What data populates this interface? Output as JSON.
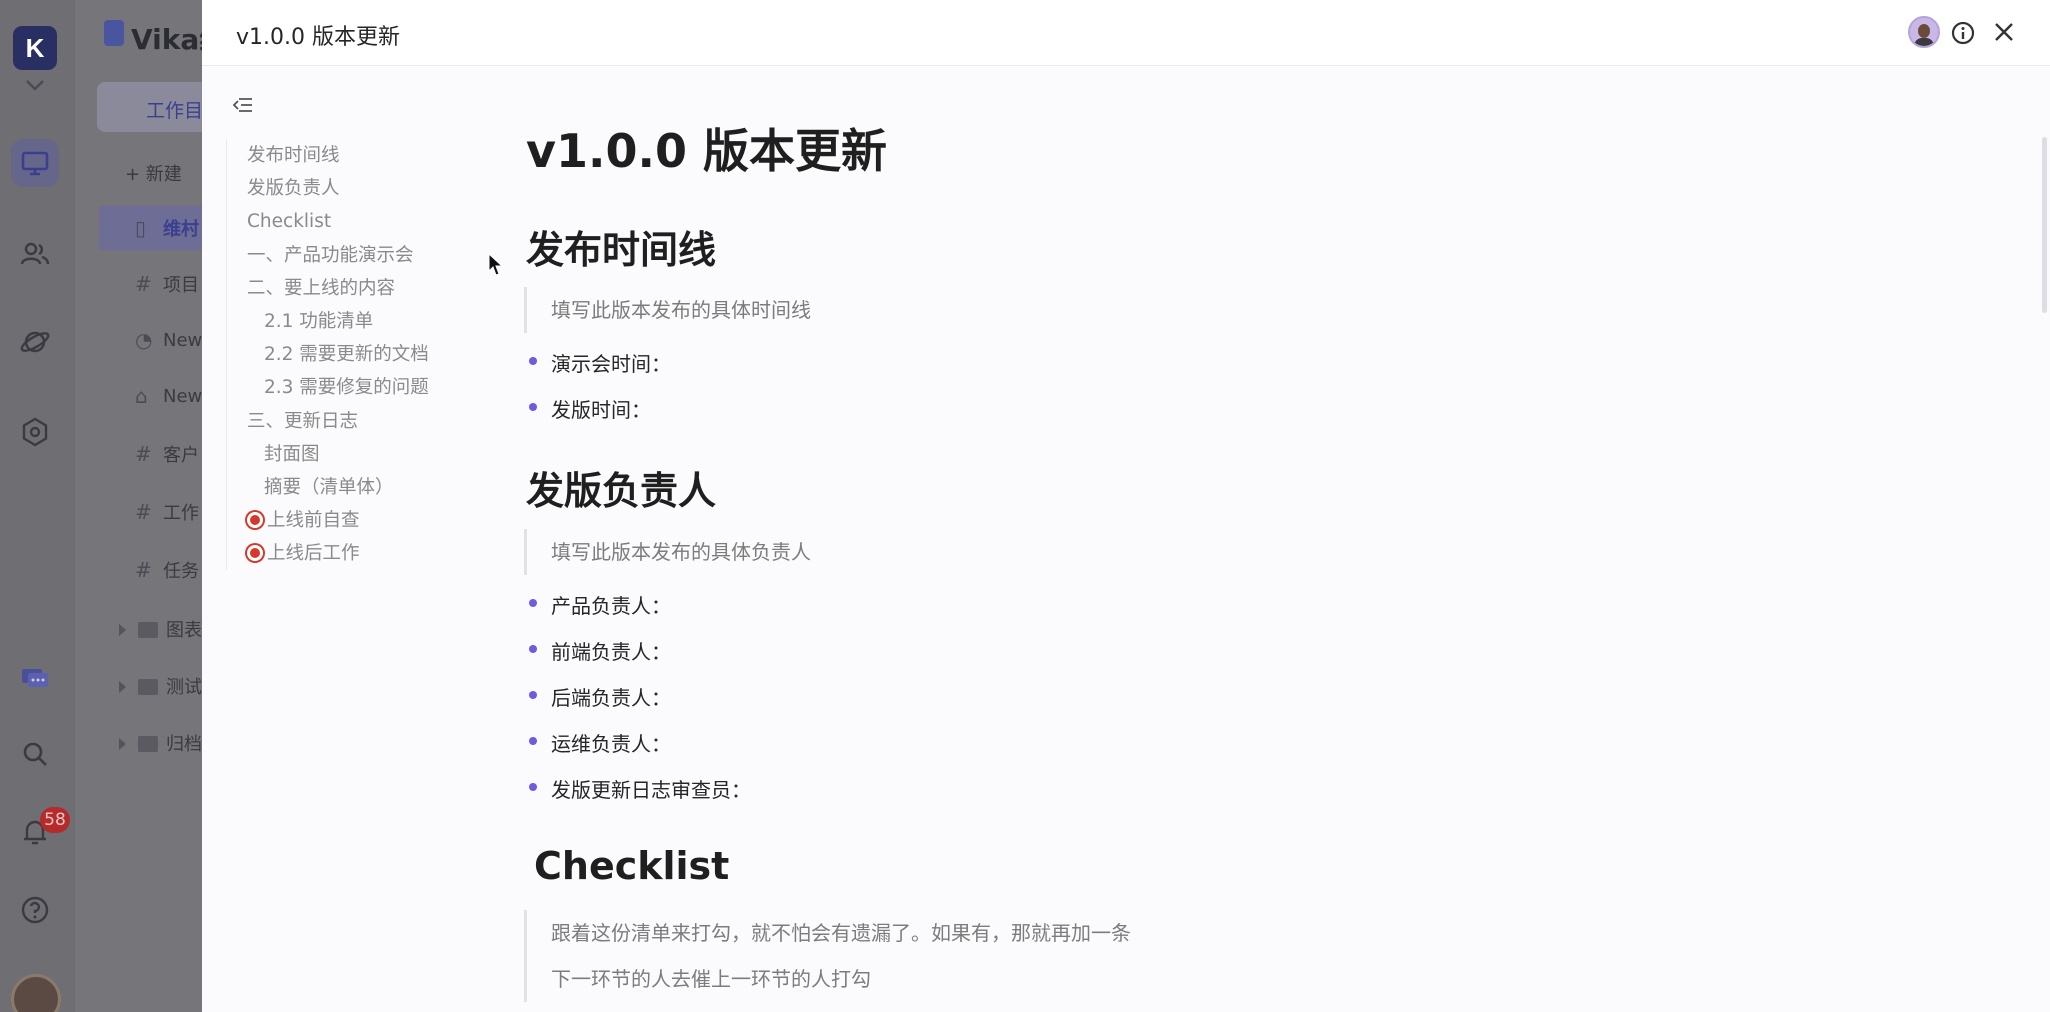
{
  "background": {
    "space_name": "Vika维",
    "catalog_tab": "工作目",
    "new_label": "+ 新建",
    "items": [
      {
        "icon": "book-icon",
        "label": "维村"
      },
      {
        "icon": "grid-icon",
        "label": "项目"
      },
      {
        "icon": "dashboard-icon",
        "label": "New"
      },
      {
        "icon": "robot-icon",
        "label": "New"
      },
      {
        "icon": "grid-icon",
        "label": "客户"
      },
      {
        "icon": "grid-icon",
        "label": "工作"
      },
      {
        "icon": "grid-icon",
        "label": "任务"
      }
    ],
    "folders": [
      "图表",
      "测试",
      "归档"
    ],
    "notification_count": "58"
  },
  "drawer": {
    "title": "v1.0.0 版本更新"
  },
  "toc": [
    {
      "label": "发布时间线",
      "level": 1
    },
    {
      "label": "发版负责人",
      "level": 1
    },
    {
      "label": "Checklist",
      "level": 1
    },
    {
      "label": "一、产品功能演示会",
      "level": 1
    },
    {
      "label": "二、要上线的内容",
      "level": 1
    },
    {
      "label": "2.1 功能清单",
      "level": 2
    },
    {
      "label": "2.2 需要更新的文档",
      "level": 2
    },
    {
      "label": "2.3 需要修复的问题",
      "level": 2
    },
    {
      "label": "三、更新日志",
      "level": 1
    },
    {
      "label": "封面图",
      "level": 2
    },
    {
      "label": "摘要（清单体）",
      "level": 2
    },
    {
      "label": "上线前自查",
      "level": 1,
      "emoji": "target-icon"
    },
    {
      "label": "上线后工作",
      "level": 1,
      "emoji": "target-icon"
    }
  ],
  "doc": {
    "title": "v1.0.0 版本更新",
    "sections": [
      {
        "heading": "发布时间线",
        "quote": [
          "填写此版本发布的具体时间线"
        ],
        "bullets": [
          "演示会时间：",
          "发版时间："
        ]
      },
      {
        "heading": "发版负责人",
        "quote": [
          "填写此版本发布的具体负责人"
        ],
        "bullets": [
          "产品负责人：",
          "前端负责人：",
          "后端负责人：",
          "运维负责人：",
          "发版更新日志审查员："
        ]
      },
      {
        "heading": "Checklist",
        "quote": [
          "跟着这份清单来打勾，就不怕会有遗漏了。如果有，那就再加一条",
          "下一环节的人去催上一环节的人打勾"
        ],
        "bullets": []
      }
    ]
  }
}
